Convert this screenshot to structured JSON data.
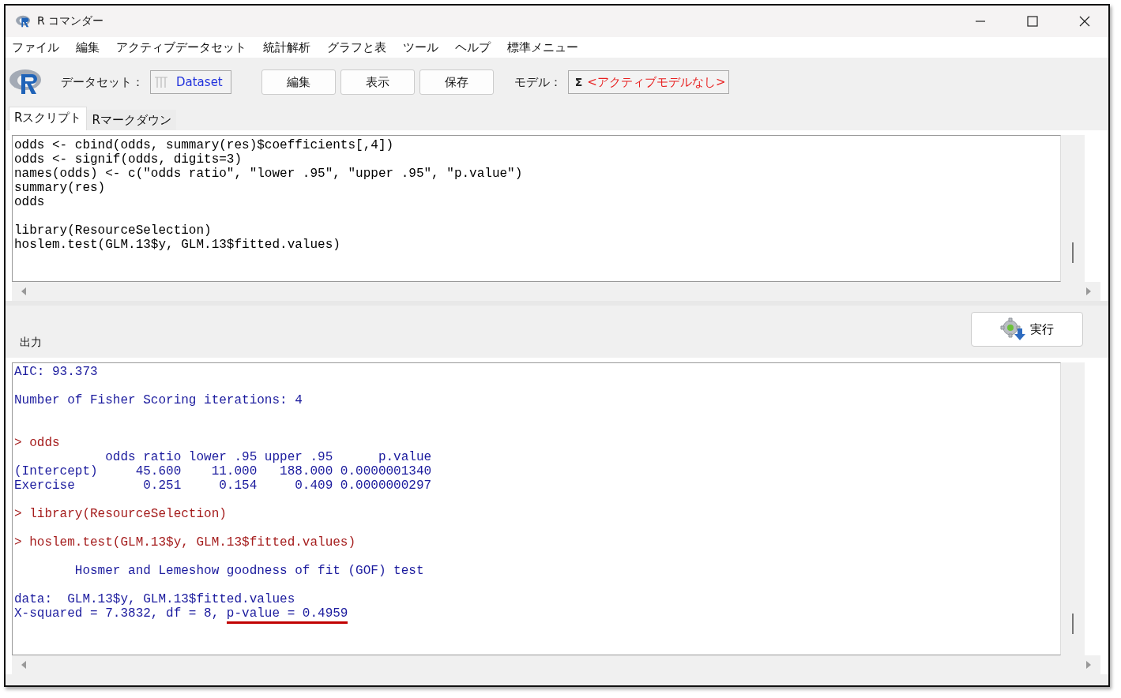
{
  "window": {
    "title": "R コマンダー"
  },
  "menu": [
    "ファイル",
    "編集",
    "アクティブデータセット",
    "統計解析",
    "グラフと表",
    "ツール",
    "ヘルプ",
    "標準メニュー"
  ],
  "toolbar": {
    "dataset_label": "データセット：",
    "dataset": "Dataset",
    "buttons": [
      "編集",
      "表示",
      "保存"
    ],
    "model_label": "モデル：",
    "model_symbol": "Σ",
    "model": "<アクティブモデルなし>"
  },
  "tabs": [
    {
      "label": "Rスクリプト",
      "selected": true
    },
    {
      "label": "Rマークダウン",
      "selected": false
    }
  ],
  "script": [
    [
      "odds <- cbind(odds, summary(res)$coefficients[,4])",
      "odds <- signif(odds, digits=3)",
      "names(odds) <- c(\"odds ratio\", \"lower .95\", \"upper .95\", \"p.value\")",
      "summary(res)",
      "odds"
    ],
    [
      "library(ResourceSelection)",
      "hoslem.test(GLM.13$y, GLM.13$fitted.values)"
    ]
  ],
  "output_label": "出力",
  "run_button": "実行",
  "output": [
    [
      {
        "kind": "output",
        "text": "AIC: 93.373"
      }
    ],
    [
      {
        "kind": "output",
        "text": "Number of Fisher Scoring iterations: 4"
      }
    ],
    [
      {
        "kind": "input",
        "text": "> odds"
      },
      {
        "kind": "output",
        "text": "            odds ratio lower .95 upper .95      p.value"
      },
      {
        "kind": "output",
        "text": "(Intercept)     45.600    11.000   188.000 0.0000001340"
      },
      {
        "kind": "output",
        "text": "Exercise         0.251     0.154     0.409 0.0000000297"
      }
    ],
    [
      {
        "kind": "input",
        "text": "> library(ResourceSelection)"
      }
    ],
    [
      {
        "kind": "input",
        "text": "> hoslem.test(GLM.13$y, GLM.13$fitted.values)"
      }
    ],
    [
      {
        "kind": "output",
        "text": "        Hosmer and Lemeshow goodness of fit (GOF) test"
      }
    ],
    [
      {
        "kind": "output",
        "text": "data:  GLM.13$y, GLM.13$fitted.values"
      },
      {
        "kind": "output",
        "text": "X-squared = 7.3832, df = 8, ",
        "underlined": "p-value = 0.4959"
      }
    ]
  ]
}
